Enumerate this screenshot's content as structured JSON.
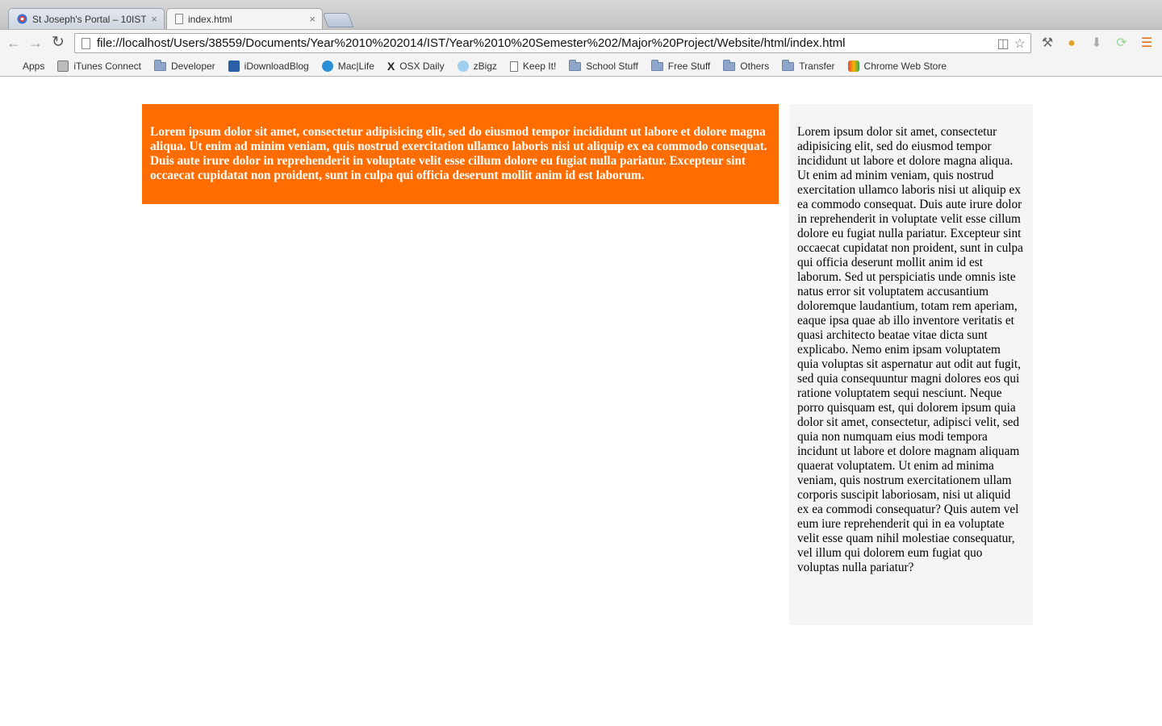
{
  "browser": {
    "tabs": [
      {
        "label": "St Joseph's Portal – 10IST",
        "active": false
      },
      {
        "label": "index.html",
        "active": true
      }
    ],
    "tab_close_glyph": "×",
    "url": "file://localhost/Users/38559/Documents/Year%2010%202014/IST/Year%2010%20Semester%202/Major%20Project/Website/html/index.html",
    "bookmarks": [
      {
        "label": "Apps",
        "icon": "apps-grid-icon"
      },
      {
        "label": "iTunes Connect",
        "icon": "apple-icon"
      },
      {
        "label": "Developer",
        "icon": "folder-icon"
      },
      {
        "label": "iDownloadBlog",
        "icon": "idb-icon"
      },
      {
        "label": "Mac|Life",
        "icon": "maclife-icon"
      },
      {
        "label": "OSX Daily",
        "icon": "osx-daily-icon"
      },
      {
        "label": "zBigz",
        "icon": "zbigz-icon"
      },
      {
        "label": "Keep It!",
        "icon": "page-icon"
      },
      {
        "label": "School Stuff",
        "icon": "folder-icon"
      },
      {
        "label": "Free Stuff",
        "icon": "folder-icon"
      },
      {
        "label": "Others",
        "icon": "folder-icon"
      },
      {
        "label": "Transfer",
        "icon": "folder-icon"
      },
      {
        "label": "Chrome Web Store",
        "icon": "chrome-web-store-icon"
      }
    ]
  },
  "page": {
    "main_text": "Lorem ipsum dolor sit amet, consectetur adipisicing elit, sed do eiusmod tempor incididunt ut labore et dolore magna aliqua. Ut enim ad minim veniam, quis nostrud exercitation ullamco laboris nisi ut aliquip ex ea commodo consequat. Duis aute irure dolor in reprehenderit in voluptate velit esse cillum dolore eu fugiat nulla pariatur. Excepteur sint occaecat cupidatat non proident, sunt in culpa qui officia deserunt mollit anim id est laborum.",
    "side_text": "Lorem ipsum dolor sit amet, consectetur adipisicing elit, sed do eiusmod tempor incididunt ut labore et dolore magna aliqua. Ut enim ad minim veniam, quis nostrud exercitation ullamco laboris nisi ut aliquip ex ea commodo consequat. Duis aute irure dolor in reprehenderit in voluptate velit esse cillum dolore eu fugiat nulla pariatur. Excepteur sint occaecat cupidatat non proident, sunt in culpa qui officia deserunt mollit anim id est laborum. Sed ut perspiciatis unde omnis iste natus error sit voluptatem accusantium doloremque laudantium, totam rem aperiam, eaque ipsa quae ab illo inventore veritatis et quasi architecto beatae vitae dicta sunt explicabo. Nemo enim ipsam voluptatem quia voluptas sit aspernatur aut odit aut fugit, sed quia consequuntur magni dolores eos qui ratione voluptatem sequi nesciunt. Neque porro quisquam est, qui dolorem ipsum quia dolor sit amet, consectetur, adipisci velit, sed quia non numquam eius modi tempora incidunt ut labore et dolore magnam aliquam quaerat voluptatem. Ut enim ad minima veniam, quis nostrum exercitationem ullam corporis suscipit laboriosam, nisi ut aliquid ex ea commodi consequatur? Quis autem vel eum iure reprehenderit qui in ea voluptate velit esse quam nihil molestiae consequatur, vel illum qui dolorem eum fugiat quo voluptas nulla pariatur?"
  },
  "colors": {
    "main_box_bg": "#ff6c00",
    "side_box_bg": "#f5f5f5"
  }
}
